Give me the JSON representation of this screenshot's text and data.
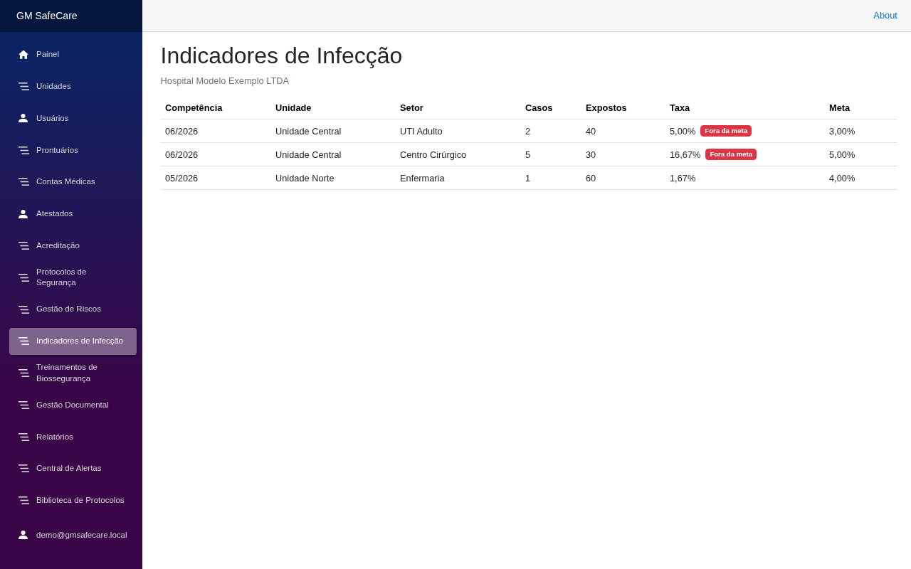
{
  "sidebar": {
    "brand": "GM SafeCare",
    "items": [
      {
        "label": "Painel",
        "kind": "home",
        "selected": false
      },
      {
        "label": "Unidades",
        "kind": "list",
        "selected": false
      },
      {
        "label": "Usuários",
        "kind": "person",
        "selected": false
      },
      {
        "label": "Prontuários",
        "kind": "list",
        "selected": false
      },
      {
        "label": "Contas Médicas",
        "kind": "list",
        "selected": false
      },
      {
        "label": "Atestados",
        "kind": "person",
        "selected": false
      },
      {
        "label": "Acreditação",
        "kind": "list",
        "selected": false
      },
      {
        "label": "Protocolos de Segurança",
        "kind": "list",
        "selected": false
      },
      {
        "label": "Gestão de Riscos",
        "kind": "list",
        "selected": false
      },
      {
        "label": "Indicadores de Infecção",
        "kind": "list",
        "selected": true
      },
      {
        "label": "Treinamentos de Biossegurança",
        "kind": "list",
        "selected": false
      },
      {
        "label": "Gestão Documental",
        "kind": "list",
        "selected": false
      },
      {
        "label": "Relatórios",
        "kind": "list",
        "selected": false
      },
      {
        "label": "Central de Alertas",
        "kind": "list",
        "selected": false
      },
      {
        "label": "Biblioteca de Protocolos",
        "kind": "list",
        "selected": false
      }
    ],
    "account": {
      "label": "demo@gmsafecare.local",
      "kind": "person"
    }
  },
  "top_bar": {
    "links": [
      "About"
    ]
  },
  "page": {
    "title": "Indicadores de Infecção",
    "subtitle": "Hospital Modelo Exemplo LTDA"
  },
  "table": {
    "columns": [
      "Competência",
      "Unidade",
      "Setor",
      "Casos",
      "Expostos",
      "Taxa",
      "Meta"
    ],
    "rows": [
      {
        "competencia": "06/2026",
        "unidade": "Unidade Central",
        "setor": "UTI Adulto",
        "casos": "2",
        "expostos": "40",
        "taxa": "5,00%",
        "taxa_badge": "Fora da meta",
        "meta": "3,00%"
      },
      {
        "competencia": "06/2026",
        "unidade": "Unidade Central",
        "setor": "Centro Cirúrgico",
        "casos": "5",
        "expostos": "30",
        "taxa": "16,67%",
        "taxa_badge": "Fora da meta",
        "meta": "5,00%"
      },
      {
        "competencia": "05/2026",
        "unidade": "Unidade Norte",
        "setor": "Enfermaria",
        "casos": "1",
        "expostos": "60",
        "taxa": "1,67%",
        "meta": "4,00%"
      }
    ]
  }
}
